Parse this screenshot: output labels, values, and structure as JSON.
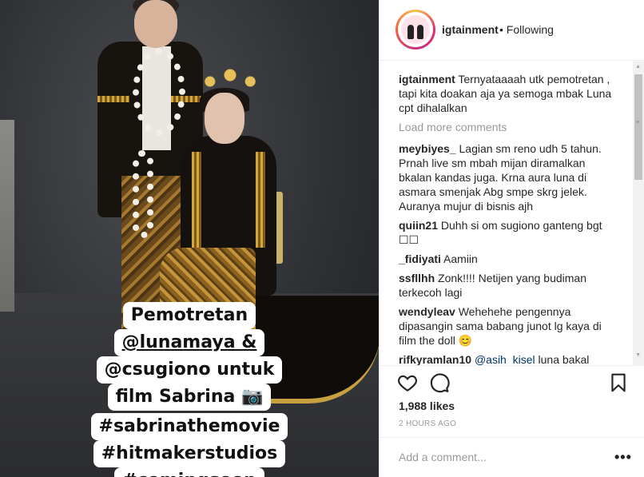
{
  "post": {
    "caption_overlay": {
      "block1": [
        "Pemotretan",
        "@lunamaya &",
        "@csugiono untuk",
        "film Sabrina 📷"
      ],
      "block2": [
        "#sabrinathemovie",
        "#hitmakerstudios",
        "#comingsoon"
      ]
    }
  },
  "header": {
    "username": "igtainment",
    "follow_status": "• Following"
  },
  "comments": [
    {
      "user": "igtainment",
      "text": "Ternyataaaah utk pemotretan , tapi kita doakan aja ya semoga mbak Luna cpt dihalalkan"
    },
    {
      "user": "meybiyes_",
      "text": "Lagian sm reno udh 5 tahun. Prnah live sm mbah mijan diramalkan bkalan kandas juga. Krna aura luna di asmara smenjak Abg smpe skrg jelek. Auranya mujur di bisnis ajh"
    },
    {
      "user": "quiin21",
      "text": "Duhh si om sugiono ganteng bgt ☐☐"
    },
    {
      "user": "_fidiyati",
      "text": "Aamiin"
    },
    {
      "user": "ssfllhh",
      "text": "Zonk!!!! Netijen yang budiman terkecoh lagi"
    },
    {
      "user": "wendyleav",
      "text": "Wehehehe pengennya dipasangin sama babang junot lg kaya di film the doll 😊"
    },
    {
      "user": "rifkyramlan10",
      "mention": "@asih_kisel",
      "text": "luna bakal nikah"
    }
  ],
  "load_more": "Load more comments",
  "likes": "1,988 likes",
  "timestamp": "2 HOURS AGO",
  "comment_placeholder": "Add a comment...",
  "more_label": "•••",
  "icons": {
    "like": "heart-icon",
    "comment": "comment-bubble-icon",
    "save": "bookmark-icon",
    "more": "more-options-icon"
  },
  "colors": {
    "text": "#262626",
    "muted": "#999999",
    "divider": "#efefef",
    "mention": "#003569"
  }
}
